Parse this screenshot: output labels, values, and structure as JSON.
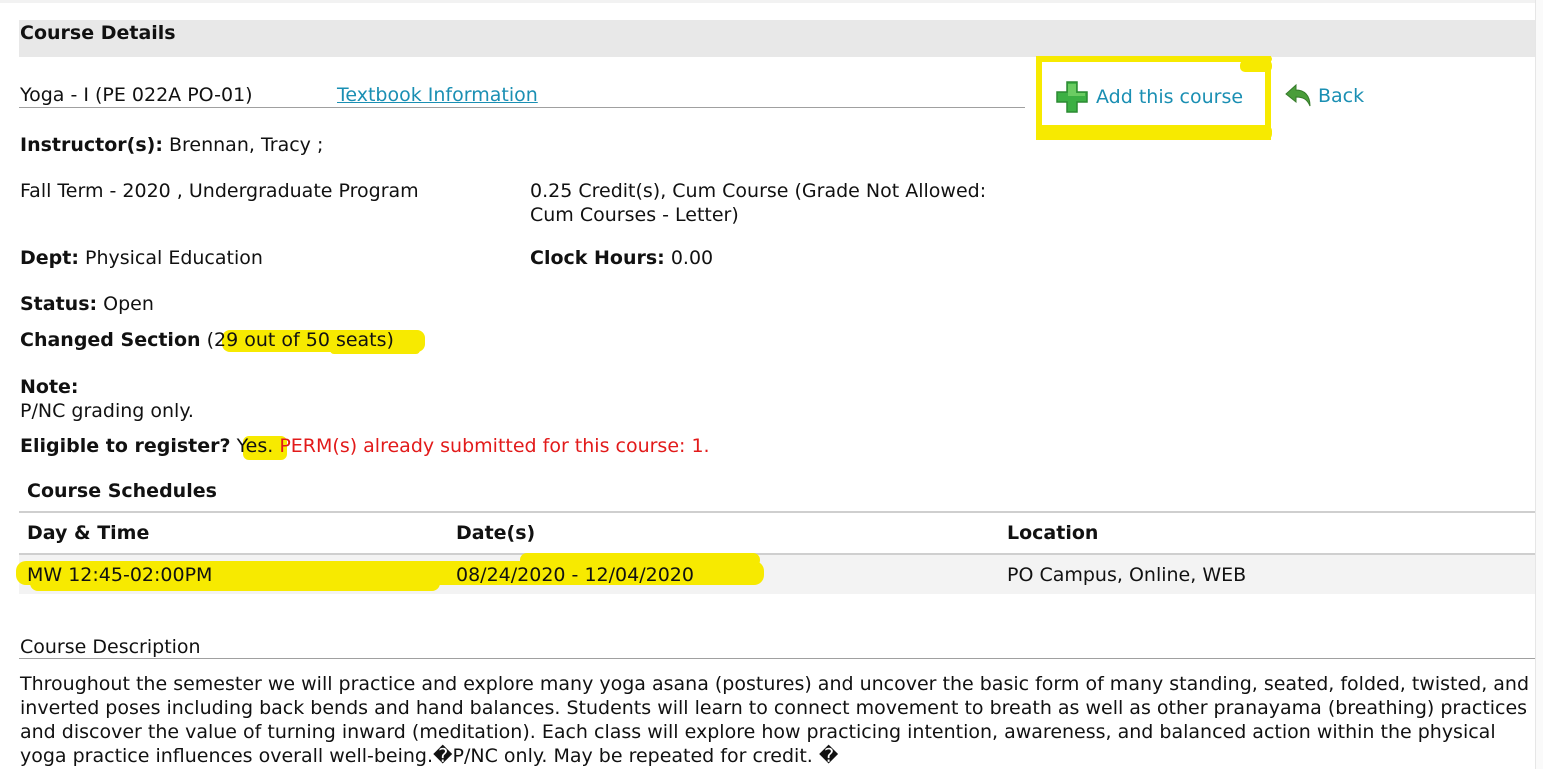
{
  "header": {
    "title": "Course Details"
  },
  "course": {
    "title": "Yoga - I (PE 022A PO-01)",
    "textbook_link": "Textbook Information",
    "instructor_label": "Instructor(s):",
    "instructor_value": "Brennan, Tracy ;",
    "term": "Fall Term - 2020 , Undergraduate Program",
    "credits_line1": "0.25 Credit(s), Cum Course (Grade Not Allowed:",
    "credits_line2": "Cum Courses - Letter)",
    "dept_label": "Dept:",
    "dept_value": "Physical Education",
    "clock_label": "Clock Hours:",
    "clock_value": "0.00",
    "status_label": "Status:",
    "status_value": "Open",
    "changed_label": "Changed Section",
    "paren_open": "(",
    "seats": "29 out of 50 seats)",
    "note_label": "Note:",
    "note_value": "P/NC grading only.",
    "eligible_label": "Eligible to register?",
    "eligible_value": "Yes",
    "eligible_period": ".",
    "perm_text": "PERM(s) already submitted for this course: 1."
  },
  "actions": {
    "add_label": "Add this course",
    "back_label": "Back"
  },
  "schedules": {
    "title": "Course Schedules",
    "columns": [
      "Day & Time",
      "Date(s)",
      "Location"
    ],
    "rows": [
      {
        "day_time": "MW 12:45-02:00PM",
        "dates": "08/24/2020 - 12/04/2020",
        "location": "PO Campus, Online, WEB"
      }
    ]
  },
  "description": {
    "title": "Course Description",
    "text": "Throughout the semester we will practice and explore many yoga asana (postures) and uncover the basic form of many standing, seated, folded, twisted, and inverted poses including back bends and hand balances. Students will learn to connect movement to breath as well as other pranayama (breathing) practices and discover the value of turning inward (meditation). Each class will explore how practicing intention, awareness, and balanced action within the physical yoga practice influences overall well-being.�P/NC only. May be repeated for credit. �"
  },
  "colors": {
    "link": "#1a8fb3",
    "highlight": "#f7ea00",
    "warning": "#e21a1a",
    "add_icon": "#3cb043",
    "back_icon": "#4a9d3a"
  }
}
